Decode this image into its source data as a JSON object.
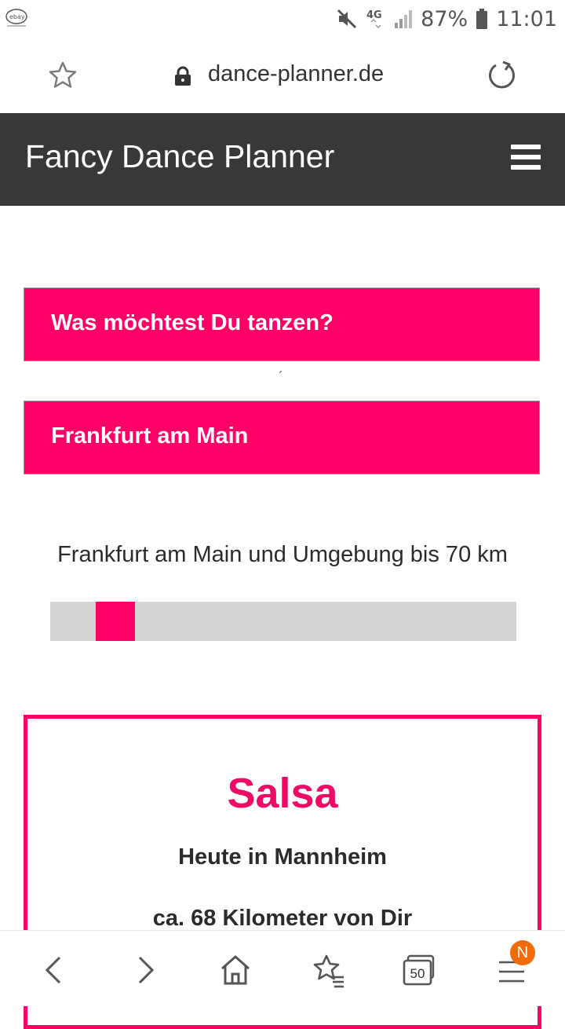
{
  "status_bar": {
    "battery_text": "87%",
    "time": "11:01",
    "network": "4G",
    "app_icon": "ebay-icon"
  },
  "browser": {
    "url": "dance-planner.de"
  },
  "header": {
    "title": "Fancy Dance Planner"
  },
  "search": {
    "dance_prompt": "Was möchtest Du tanzen?",
    "location": "Frankfurt am Main",
    "radius_label": "Frankfurt am Main und Umgebung bis 70 km",
    "radius_fraction": 0.14
  },
  "event_card": {
    "dance": "Salsa",
    "when_where": "Heute in Mannheim",
    "distance": "ca. 68 Kilometer von Dir"
  },
  "bottom_nav": {
    "tabs_count": "50",
    "badge": "N"
  },
  "colors": {
    "accent": "#ff0066",
    "header_bg": "#383838",
    "badge": "#f26b0b"
  }
}
